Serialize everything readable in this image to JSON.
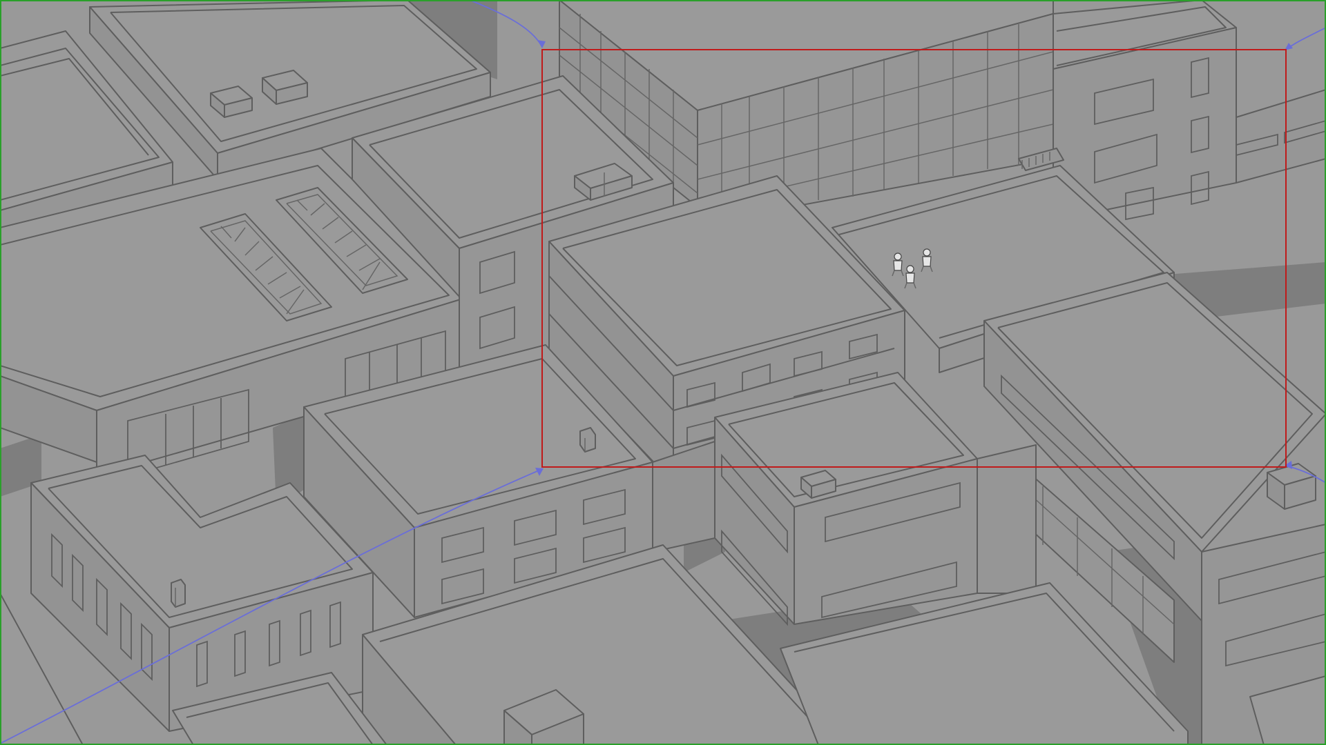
{
  "scene": {
    "type": "isometric-city-sketch",
    "colors": {
      "background": "#999999",
      "line": "#5e5e5e",
      "shadow": "#7e7e7e",
      "frame_border": "#2aa02a",
      "selection_box": "#c01a1a",
      "path_arrow": "#6a6ed8"
    },
    "characters": [
      {
        "name": "figure-1"
      },
      {
        "name": "figure-2"
      },
      {
        "name": "figure-3"
      }
    ]
  }
}
